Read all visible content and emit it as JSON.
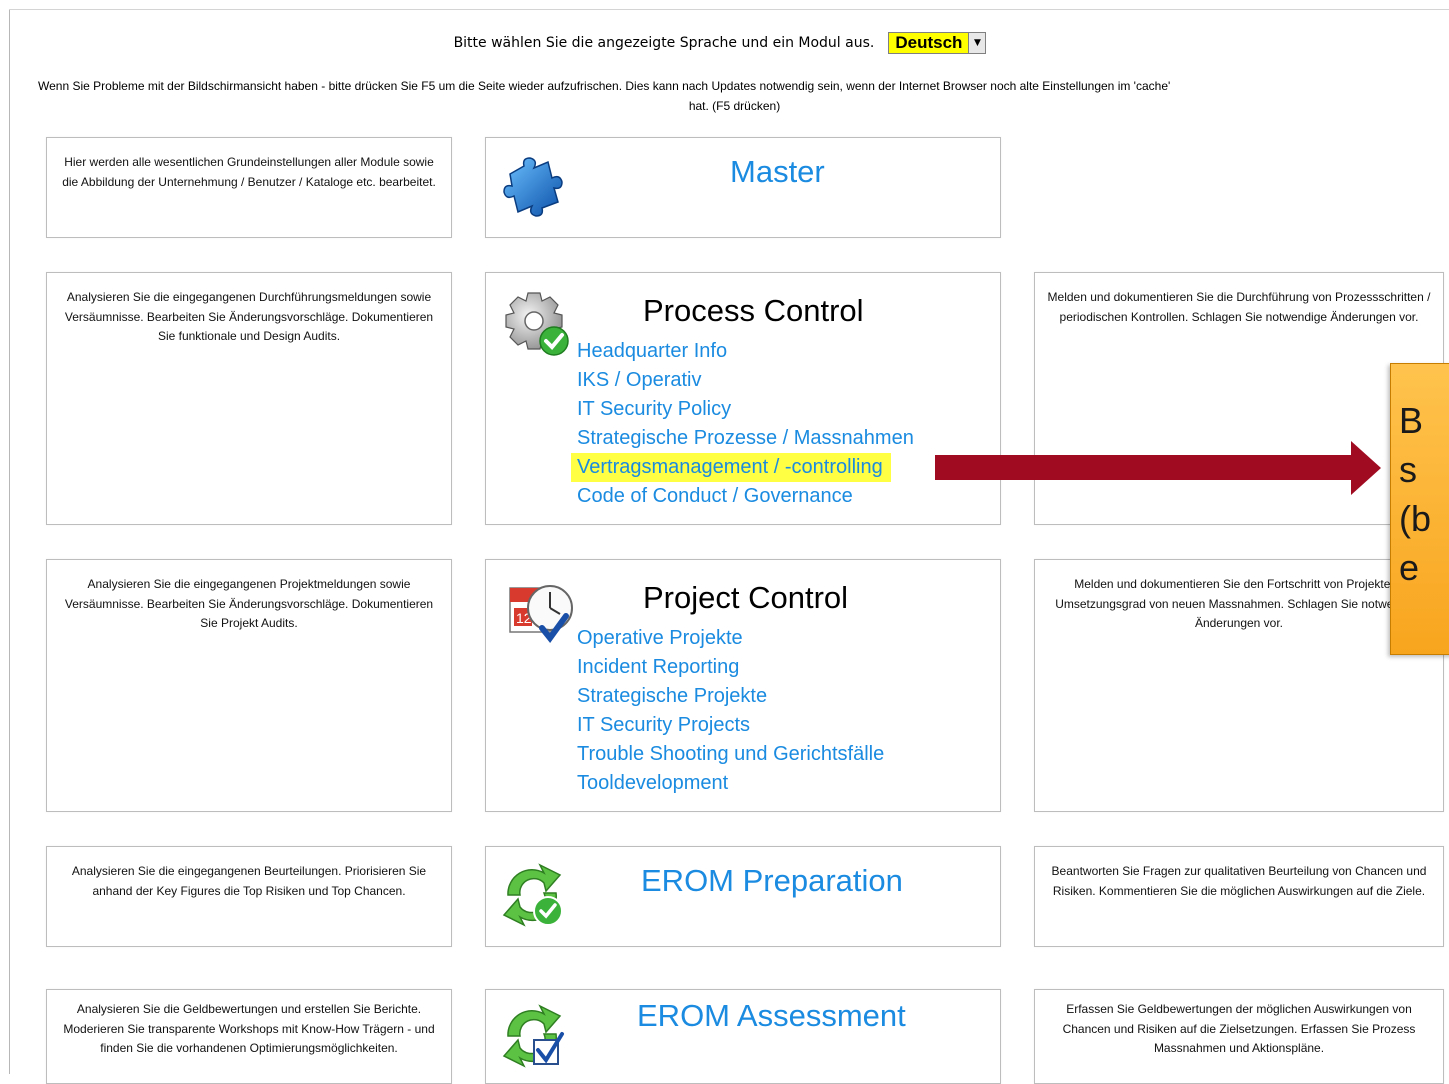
{
  "header": {
    "language_prompt": "Bitte wählen Sie die angezeigte Sprache und ein Modul aus.",
    "language_selected": "Deutsch",
    "info_line1": "Wenn Sie Probleme mit der Bildschirmansicht haben - bitte drücken Sie F5 um die Seite wieder aufzufrischen. Dies kann nach Updates notwendig sein, wenn der Internet Browser noch alte Einstellungen im 'cache'",
    "info_line2": "hat. (F5 drücken)"
  },
  "master": {
    "left_desc": "Hier werden alle wesentlichen Grundeinstellungen aller Module sowie die Abbildung der Unternehmung / Benutzer / Kataloge etc. bearbeitet.",
    "title": "Master"
  },
  "process_control": {
    "left_desc": "Analysieren Sie die eingegangenen Durchführungsmeldungen sowie Versäumnisse. Bearbeiten Sie Änderungsvorschläge. Dokumentieren Sie funktionale und Design Audits.",
    "title": "Process Control",
    "links": [
      "Headquarter Info",
      "IKS / Operativ",
      "IT Security Policy",
      "Strategische Prozesse / Massnahmen",
      "Vertragsmanagement / -controlling",
      "Code of Conduct / Governance"
    ],
    "right_desc": "Melden und dokumentieren Sie die Durchführung von Prozessschritten / periodischen Kontrollen. Schlagen Sie notwendige Änderungen vor."
  },
  "project_control": {
    "left_desc": "Analysieren Sie die eingegangenen Projektmeldungen sowie Versäumnisse. Bearbeiten Sie Änderungsvorschläge. Dokumentieren Sie Projekt Audits.",
    "title": "Project Control",
    "links": [
      "Operative Projekte",
      "Incident Reporting",
      "Strategische Projekte",
      "IT Security Projects",
      "Trouble Shooting und Gerichtsfälle",
      "Tooldevelopment"
    ],
    "right_desc": "Melden und dokumentieren Sie den Fortschritt von Projekten / Umsetzungsgrad von neuen Massnahmen. Schlagen Sie notwendige Änderungen vor."
  },
  "erom_preparation": {
    "left_desc": "Analysieren Sie die eingegangenen Beurteilungen. Priorisieren Sie anhand der Key Figures die Top Risiken und Top Chancen.",
    "title": "EROM Preparation",
    "right_desc": "Beantworten Sie Fragen zur qualitativen Beurteilung von Chancen und Risiken. Kommentieren Sie die möglichen Auswirkungen auf die Ziele."
  },
  "erom_assessment": {
    "left_desc": "Analysieren Sie die Geldbewertungen und erstellen Sie Berichte. Moderieren Sie transparente Workshops mit Know-How Trägern - und finden Sie die vorhandenen Optimierungsmöglichkeiten.",
    "title": "EROM Assessment",
    "right_desc": "Erfassen Sie Geldbewertungen der möglichen Auswirkungen von Chancen und Risiken auf die Zielsetzungen. Erfassen Sie Prozess Massnahmen und Aktionspläne."
  },
  "callout": {
    "lines": [
      "B",
      "s",
      "(b",
      "e"
    ]
  },
  "colors": {
    "link_blue": "#1a8be0",
    "highlight": "#ffff44",
    "arrow": "#a00b22",
    "callout_orange": "#f8a51e",
    "select_yellow": "#ffff00"
  }
}
